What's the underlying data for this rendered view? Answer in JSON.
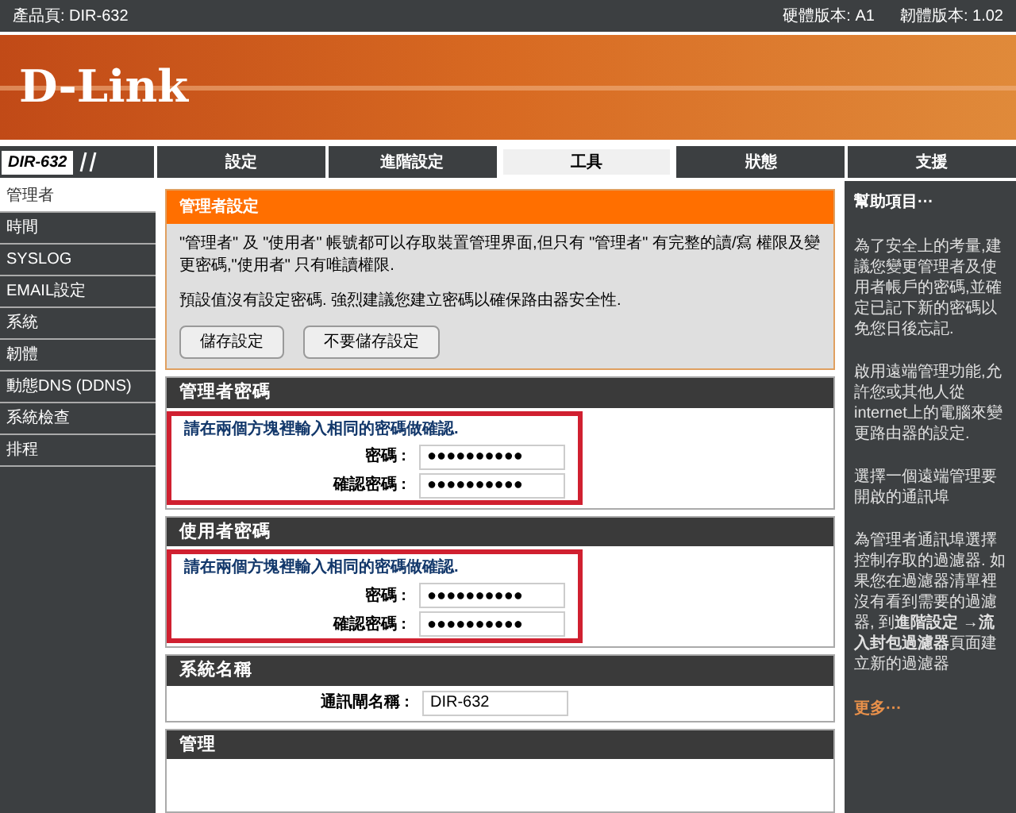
{
  "top_bar": {
    "product": "產品頁: DIR-632",
    "hardware": "硬體版本: A1",
    "firmware": "韌體版本: 1.02"
  },
  "banner": {
    "logo": "D-Link"
  },
  "model_badge": "DIR-632",
  "tabs": [
    {
      "label": "設定",
      "selected": false
    },
    {
      "label": "進階設定",
      "selected": false
    },
    {
      "label": "工具",
      "selected": true
    },
    {
      "label": "狀態",
      "selected": false
    },
    {
      "label": "支援",
      "selected": false
    }
  ],
  "sidebar": {
    "items": [
      {
        "label": "管理者",
        "selected": true
      },
      {
        "label": "時間",
        "selected": false
      },
      {
        "label": "SYSLOG",
        "selected": false
      },
      {
        "label": "EMAIL設定",
        "selected": false
      },
      {
        "label": "系統",
        "selected": false
      },
      {
        "label": "韌體",
        "selected": false
      },
      {
        "label": "動態DNS (DDNS)",
        "selected": false
      },
      {
        "label": "系統檢查",
        "selected": false
      },
      {
        "label": "排程",
        "selected": false
      }
    ]
  },
  "intro": {
    "title": "管理者設定",
    "paragraphs": [
      "\"管理者\" 及 \"使用者\" 帳號都可以存取裝置管理界面,但只有 \"管理者\" 有完整的讀/寫 權限及變更密碼,\"使用者\" 只有唯讀權限.",
      "預設值沒有設定密碼. 強烈建議您建立密碼以確保路由器安全性."
    ],
    "buttons": [
      "儲存設定",
      "不要儲存設定"
    ]
  },
  "password_sections": [
    {
      "title": "管理者密碼",
      "highlighted": true,
      "hint": "請在兩個方塊裡輸入相同的密碼做確認.",
      "fields": [
        {
          "label": "密碼 :",
          "value": "●●●●●●●●●●"
        },
        {
          "label": "確認密碼 :",
          "value": "●●●●●●●●●●"
        }
      ]
    },
    {
      "title": "使用者密碼",
      "highlighted": true,
      "hint": "請在兩個方塊裡輸入相同的密碼做確認.",
      "fields": [
        {
          "label": "密碼 :",
          "value": "●●●●●●●●●●"
        },
        {
          "label": "確認密碼 :",
          "value": "●●●●●●●●●●"
        }
      ]
    }
  ],
  "system_name": {
    "title": "系統名稱",
    "label": "通訊閘名稱 :",
    "value": "DIR-632"
  },
  "management": {
    "title": "管理"
  },
  "help": {
    "title": "幫助項目···",
    "paragraphs": [
      "為了安全上的考量,建議您變更管理者及使用者帳戶的密碼,並確定已記下新的密碼以免您日後忘記.",
      "啟用遠端管理功能,允許您或其他人從internet上的電腦來變更路由器的設定.",
      "選擇一個遠端管理要開啟的通訊埠",
      "為管理者通訊埠選擇控制存取的過濾器. 如果您在過濾器清單裡沒有看到需要的過濾器, 到**進階設定 →流入封包過濾器**頁面建立新的過濾器"
    ],
    "more": "更多···"
  }
}
